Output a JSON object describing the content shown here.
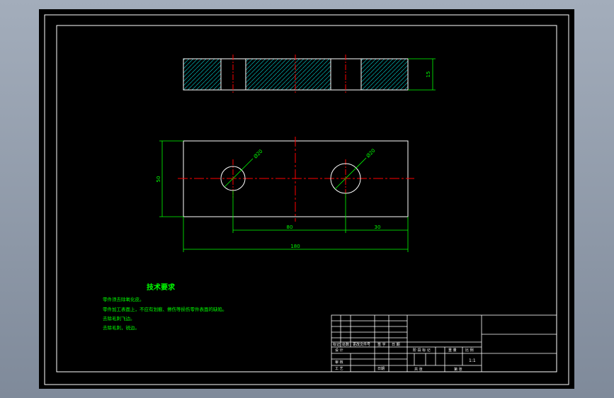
{
  "dimensions": {
    "thickness": "15",
    "height": "50",
    "hole_left": "Ø20",
    "hole_right": "Ø20",
    "center_distance": "80",
    "edge_distance": "30",
    "overall_length": "180"
  },
  "tech": {
    "title": "技术要求",
    "lines": [
      "零件须去除氧化皮。",
      "零件加工表面上，不应有划痕、擦伤等损伤零件表面的缺陷。",
      "去除毛刺飞边。",
      "去除毛刺，锐边。"
    ]
  },
  "title_block": {
    "rev_headers": [
      "标记",
      "处数",
      "更改文件号",
      "签 字",
      "日 期"
    ],
    "designer": "设 计",
    "stage_mark": "阶 段 标 记",
    "weight": "重 量",
    "scale_label": "比 例",
    "scale": "1:1",
    "approve": "审 核",
    "process": "工 艺",
    "date": "日期",
    "sheet_total": "共  张",
    "sheet_no": "第  张"
  },
  "colors": {
    "outline": "#ffffff",
    "dimension": "#00ff00",
    "centerline": "#ff0000",
    "hatch": "#00c0c0",
    "background": "#000000"
  }
}
